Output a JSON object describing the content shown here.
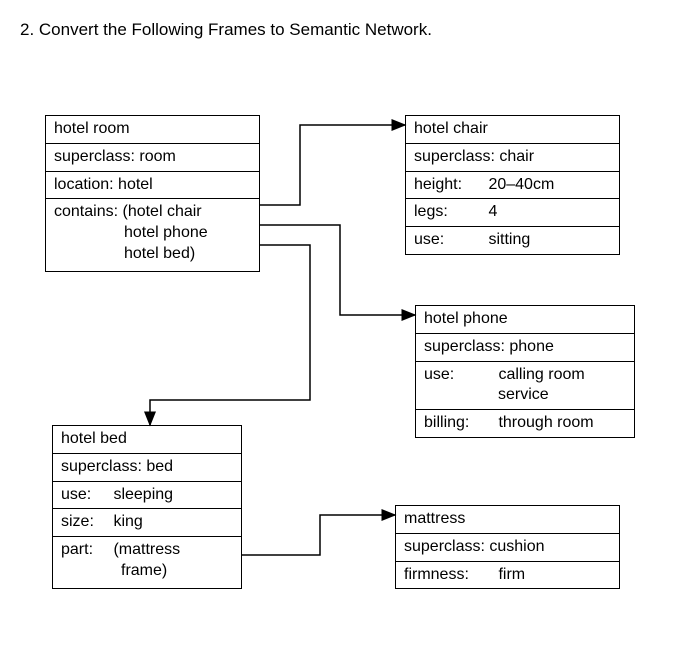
{
  "title": "2.   Convert the Following Frames to Semantic Network.",
  "frames": {
    "hotel_room": {
      "name": "hotel room",
      "superclass": "superclass: room",
      "location": "location:   hotel",
      "contains1": "contains: (hotel chair",
      "contains2": "hotel phone",
      "contains3": "hotel bed)"
    },
    "hotel_chair": {
      "name": "hotel chair",
      "superclass": "superclass: chair",
      "height_k": "height:",
      "height_v": "20–40cm",
      "legs_k": "legs:",
      "legs_v": "4",
      "use_k": "use:",
      "use_v": "sitting"
    },
    "hotel_phone": {
      "name": "hotel phone",
      "superclass": "superclass: phone",
      "use_k": "use:",
      "use_v1": "calling room",
      "use_v2": "service",
      "billing_k": "billing:",
      "billing_v": "through room"
    },
    "hotel_bed": {
      "name": "hotel bed",
      "superclass": "superclass: bed",
      "use_k": "use:",
      "use_v": "sleeping",
      "size_k": "size:",
      "size_v": "king",
      "part_k": "part:",
      "part_v1": "(mattress",
      "part_v2": "frame)"
    },
    "mattress": {
      "name": "mattress",
      "superclass": "superclass:   cushion",
      "firmness_k": "firmness:",
      "firmness_v": "firm"
    }
  },
  "chart_data": {
    "type": "diagram",
    "title": "Convert the Following Frames to Semantic Network.",
    "frames": [
      {
        "name": "hotel room",
        "slots": {
          "superclass": "room",
          "location": "hotel",
          "contains": [
            "hotel chair",
            "hotel phone",
            "hotel bed"
          ]
        }
      },
      {
        "name": "hotel chair",
        "slots": {
          "superclass": "chair",
          "height": "20–40cm",
          "legs": 4,
          "use": "sitting"
        }
      },
      {
        "name": "hotel phone",
        "slots": {
          "superclass": "phone",
          "use": "calling room service",
          "billing": "through room"
        }
      },
      {
        "name": "hotel bed",
        "slots": {
          "superclass": "bed",
          "use": "sleeping",
          "size": "king",
          "part": [
            "mattress",
            "frame"
          ]
        }
      },
      {
        "name": "mattress",
        "slots": {
          "superclass": "cushion",
          "firmness": "firm"
        }
      }
    ],
    "edges": [
      {
        "from": "hotel room",
        "slot": "contains",
        "to": "hotel chair"
      },
      {
        "from": "hotel room",
        "slot": "contains",
        "to": "hotel phone"
      },
      {
        "from": "hotel room",
        "slot": "contains",
        "to": "hotel bed"
      },
      {
        "from": "hotel bed",
        "slot": "part",
        "to": "mattress"
      }
    ]
  }
}
